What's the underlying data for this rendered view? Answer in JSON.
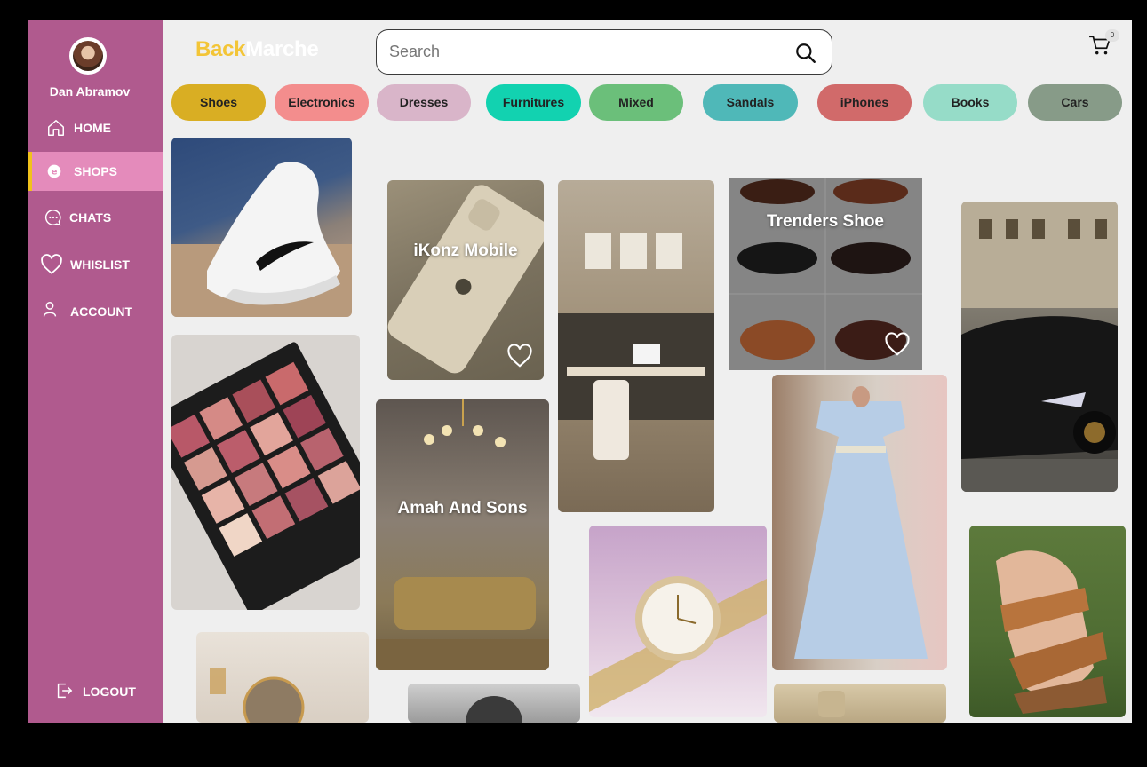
{
  "user": {
    "name": "Dan Abramov"
  },
  "brand": {
    "part1": "Back",
    "part2": "Marche"
  },
  "search": {
    "placeholder": "Search"
  },
  "cart": {
    "count": "0"
  },
  "nav": {
    "home": "HOME",
    "shops": "SHOPS",
    "chats": "CHATS",
    "whislist": "WHISLIST",
    "account": "ACCOUNT",
    "logout": "LOGOUT"
  },
  "categories": [
    {
      "label": "Shoes",
      "color": "#d9ae23"
    },
    {
      "label": "Electronics",
      "color": "#f38d8d"
    },
    {
      "label": "Dresses",
      "color": "#d9b5c9"
    },
    {
      "label": "Furnitures",
      "color": "#12d2b0"
    },
    {
      "label": "Mixed",
      "color": "#6bbf7a"
    },
    {
      "label": "Sandals",
      "color": "#4fb8b8"
    },
    {
      "label": "iPhones",
      "color": "#d16a6a"
    },
    {
      "label": "Books",
      "color": "#96dcc8"
    },
    {
      "label": "Cars",
      "color": "#879b88"
    }
  ],
  "shops": {
    "ikonz": "iKonz Mobile",
    "trenders": "Trenders Shoe",
    "amah": "Amah And Sons"
  },
  "colors": {
    "sidebar": "#b05a8e",
    "active": "#e48bbb",
    "accent": "#f1c21b"
  }
}
